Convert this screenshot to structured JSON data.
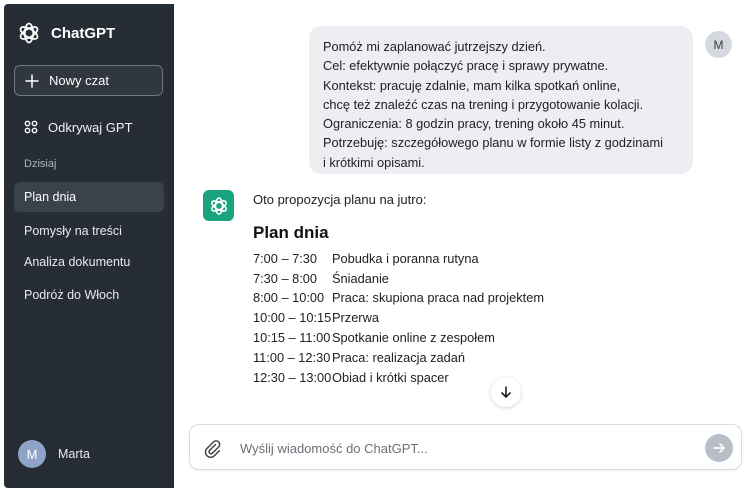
{
  "app": {
    "name": "ChatGPT"
  },
  "sidebar": {
    "new_chat_label": "Nowy czat",
    "explore_label": "Odkrywaj GPT",
    "section_label": "Dzisiaj",
    "items": [
      {
        "label": "Plan dnia",
        "active": true
      },
      {
        "label": "Pomysły na treści",
        "active": false
      },
      {
        "label": "Analiza dokumentu",
        "active": false
      },
      {
        "label": "Podróż do Włoch",
        "active": false
      }
    ],
    "user": {
      "initial": "M",
      "name": "Marta"
    }
  },
  "conversation": {
    "user_avatar_initial": "M",
    "user_message_lines": [
      "Pomóż mi zaplanować jutrzejszy dzień.",
      "Cel: efektywnie połączyć pracę i sprawy prywatne.",
      "Kontekst: pracuję zdalnie, mam kilka spotkań online,",
      "chcę też znaleźć czas na trening i przygotowanie kolacji.",
      "Ograniczenia: 8 godzin pracy, trening około 45 minut.",
      "Potrzebuję: szczegółowego planu w formie listy z godzinami",
      "i krótkimi opisami."
    ],
    "assistant_intro": "Oto propozycja planu na jutro:",
    "plan_title": "Plan dnia",
    "plan_rows": [
      {
        "time": "7:00 – 7:30",
        "desc": "Pobudka i poranna rutyna"
      },
      {
        "time": "7:30 – 8:00",
        "desc": "Śniadanie"
      },
      {
        "time": "8:00 – 10:00",
        "desc": "Praca: skupiona praca nad projektem"
      },
      {
        "time": "10:00 – 10:15",
        "desc": "Przerwa"
      },
      {
        "time": "10:15 – 11:00",
        "desc": "Spotkanie online z zespołem"
      },
      {
        "time": "11:00 – 12:30",
        "desc": "Praca: realizacja zadań"
      },
      {
        "time": "12:30 – 13:00",
        "desc": "Obiad i krótki spacer"
      }
    ]
  },
  "composer": {
    "placeholder": "Wyślij wiadomość do ChatGPT...",
    "value": ""
  },
  "colors": {
    "sidebar_bg": "#262d35",
    "accent_green": "#19a37f",
    "user_bubble_bg": "#eceef1",
    "send_button_bg": "#b8bec6"
  },
  "icons": {
    "logo": "chatgpt-logo-icon",
    "new_chat": "plus-icon",
    "explore": "grid-icon",
    "attach": "paperclip-icon",
    "send": "arrow-right-icon",
    "scroll": "arrow-down-icon"
  }
}
